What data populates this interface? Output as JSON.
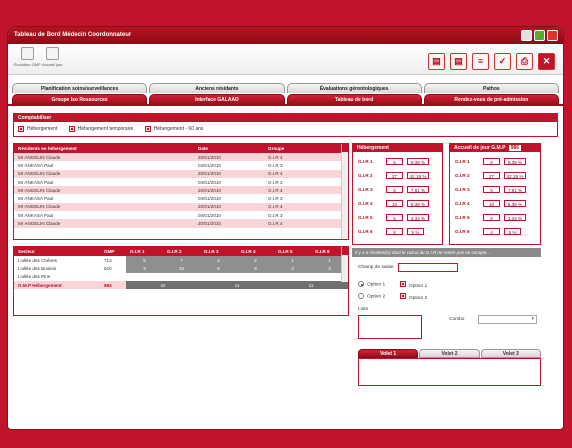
{
  "window": {
    "title": "Tableau de Bord Médecin Coordonnateur"
  },
  "toolbar": {
    "left_buttons": [
      "Évolution GMP",
      "Accueil jour"
    ],
    "tools": [
      "doc-icon",
      "doc-icon",
      "list-icon",
      "check-doc-icon",
      "print-icon",
      "close-icon"
    ]
  },
  "tabs_row1": [
    "Planification soins/surveillances",
    "Anciens résidants",
    "Évaluations gérontologiques",
    "Pathos"
  ],
  "tabs_row2": [
    "Groupe Iso Ressources",
    "Interface GALAAD",
    "Tableau de bord",
    "Rendez-vous de pré-admission"
  ],
  "comptabiliser": {
    "title": "Comptabiliser",
    "options": [
      "Hébergement",
      "Hébergement temporaire",
      "Hébergement - 60 ans"
    ]
  },
  "residents": {
    "headers": [
      "Résidents en hébergement",
      "Date",
      "Groupe"
    ],
    "rows": [
      [
        "Mr ANGELIN Claude",
        "20/01/2010",
        "G.I.R 4"
      ],
      [
        "Mr ANKASA Paul",
        "04/01/2010",
        "G.I.R 3"
      ],
      [
        "Mr ANGELIN Claude",
        "20/01/2010",
        "G.I.R 4"
      ],
      [
        "Mr ANKASA Paul",
        "04/01/2010",
        "G.I.R 2"
      ],
      [
        "Mr ANGELIN Claude",
        "20/01/2010",
        "G.I.R 4"
      ],
      [
        "Mr ANKASA Paul",
        "04/01/2010",
        "G.I.R 3"
      ],
      [
        "Mr ANGELIN Claude",
        "20/01/2010",
        "G.I.R 4"
      ],
      [
        "Mr ANKASA Paul",
        "04/01/2010",
        "G.I.R 3"
      ],
      [
        "Mr ANGELIN Claude",
        "20/01/2010",
        "G.I.R 4"
      ]
    ]
  },
  "secteur": {
    "headers": [
      "Secteur",
      "GMP",
      "G.I.R 1",
      "G.I.R 2",
      "G.I.R 3",
      "G.I.R 4",
      "G.I.R 5",
      "G.I.R 6"
    ],
    "rows": [
      [
        "L'allée des Chênes",
        "713",
        "5",
        "7",
        "4",
        "2",
        "1",
        "1"
      ],
      [
        "L'allée des Bouleis",
        "620",
        "3",
        "10",
        "6",
        "9",
        "3",
        "3"
      ],
      [
        "L'allée des Pins",
        "",
        "",
        "",
        "",
        "",
        "",
        ""
      ]
    ],
    "total": [
      "G.M.P Hébergement",
      "684",
      "22",
      "11",
      "11"
    ]
  },
  "hebergement": {
    "title": "Hébergement",
    "rows": [
      [
        "G.I.R 1",
        "6",
        "9,38 %"
      ],
      [
        "G.I.R 2",
        "27",
        "42,19 %"
      ],
      [
        "G.I.R 3",
        "5",
        "7,81 %"
      ],
      [
        "G.I.R 4",
        "10",
        "8,38 %"
      ],
      [
        "G.I.R 5",
        "6",
        "3,34 %"
      ],
      [
        "G.I.R 6",
        "6",
        "5 %"
      ]
    ]
  },
  "accueil": {
    "title": "Accueil de jour G.M.P",
    "badge": "986",
    "rows": [
      [
        "G.I.R 1",
        "6",
        "9,38 %"
      ],
      [
        "G.I.R 2",
        "27",
        "42,19 %"
      ],
      [
        "G.I.R 3",
        "5",
        "7,81 %"
      ],
      [
        "G.I.R 4",
        "10",
        "8,38 %"
      ],
      [
        "G.I.R 5",
        "6",
        "3,34 %"
      ],
      [
        "G.I.R 6",
        "4",
        "5 %"
      ]
    ]
  },
  "note": "Il y a 5 résident(s) dont le calcul du G.I.R ne rentre pas en compte...",
  "form": {
    "champ_label": "Champ de saisie",
    "options": [
      "Option 1",
      "Option 2",
      "Option 1",
      "Option 2"
    ],
    "liste_label": "Liste",
    "combo_label": "Combo"
  },
  "volets": [
    "Volet 1",
    "Volet 2",
    "Volet 3"
  ]
}
